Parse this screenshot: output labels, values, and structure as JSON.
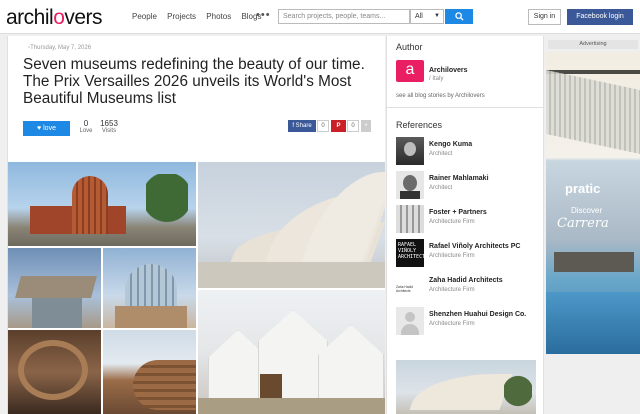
{
  "header": {
    "logo_main": "archil",
    "logo_accent": "o",
    "logo_end": "vers",
    "nav": [
      "People",
      "Projects",
      "Photos",
      "Blogs"
    ],
    "more": "•••",
    "search_placeholder": "Search projects, people, teams...",
    "filter_value": "All",
    "signin_label": "Sign in",
    "facebook_label": "Facebook login"
  },
  "article": {
    "date": "Thursday, May 7, 2026",
    "title": "Seven museums redefining the beauty of our time. The Prix Versailles 2026 unveils its World's Most Beautiful Museums list",
    "love_label": "love",
    "love_count": "0",
    "love_text": "Love",
    "visits_count": "1653",
    "visits_text": "Visits",
    "fb_share_label": "Share",
    "fb_share_count": "0",
    "pin_label": "P",
    "pin_count": "0",
    "plus_label": "+"
  },
  "sidebar": {
    "author_heading": "Author",
    "author_logo_letter": "a",
    "author_name": "Archilovers",
    "author_location": "/ Italy",
    "see_all": "see all blog stories by  Archilovers",
    "references_heading": "References",
    "references": [
      {
        "name": "Kengo Kuma",
        "type": "Architect"
      },
      {
        "name": "Rainer Mahlamaki",
        "type": "Architect"
      },
      {
        "name": "Foster + Partners",
        "type": "Architecture Firm"
      },
      {
        "name": "Rafael Viñoly Architects PC",
        "type": "Architecture Firm",
        "thumb_text": "RAFAEL VIÑOLY ARCHITECTS"
      },
      {
        "name": "Zaha Hadid Architects",
        "type": "Architecture Firm",
        "thumb_text": "Zaha Hadid Architects"
      },
      {
        "name": "Shenzhen Huahui Design Co.",
        "type": "Architecture Firm"
      }
    ]
  },
  "ad": {
    "label": "Advertising",
    "brand": "pratic",
    "discover": "Discover",
    "product": "Carrera"
  },
  "colors": {
    "brand_pink": "#e91e63",
    "primary_blue": "#1e88e5",
    "facebook_blue": "#3b5998",
    "pinterest_red": "#cb2027"
  }
}
